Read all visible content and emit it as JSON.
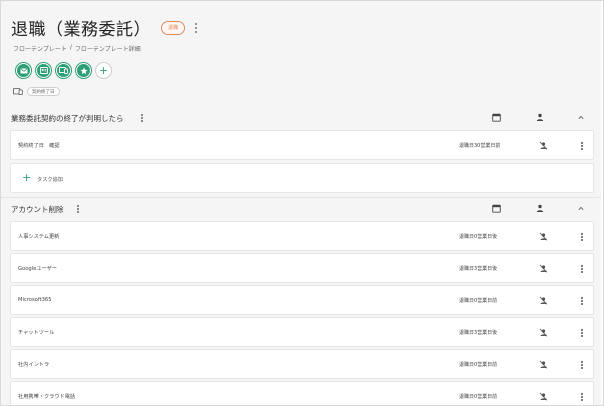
{
  "header": {
    "title": "退職（業務委託）",
    "status_badge": "退職",
    "breadcrumb": [
      "フローテンプレート",
      "/",
      "フローテンプレート詳細"
    ],
    "tag": "契約終了日"
  },
  "actions": [
    {
      "icon": "mail-icon"
    },
    {
      "icon": "id-card-icon"
    },
    {
      "icon": "device-icon"
    },
    {
      "icon": "star-icon"
    },
    {
      "icon": "plus-icon"
    }
  ],
  "sections": [
    {
      "title": "業務委託契約の終了が判明したら",
      "tasks": [
        {
          "name": "契約終了日　確認",
          "due": "退職日30営業日前"
        }
      ],
      "add_task_label": "タスク追加"
    },
    {
      "title": "アカウント削除",
      "tasks": [
        {
          "name": "人事システム更新",
          "due": "退職日0営業日後"
        },
        {
          "name": "Googleユーザー",
          "due": "退職日3営業日後"
        },
        {
          "name": "Microsoft365",
          "due": "退職日0営業日前"
        },
        {
          "name": "チャットツール",
          "due": "退職日3営業日後"
        },
        {
          "name": "社内イントラ",
          "due": "退職日0営業日前"
        },
        {
          "name": "社用携帯・クラウド電話",
          "due": "退職日0営業日前"
        }
      ]
    }
  ],
  "colors": {
    "accent": "#2e9f74",
    "badge": "#e08a64",
    "background": "#f5f5f5"
  }
}
